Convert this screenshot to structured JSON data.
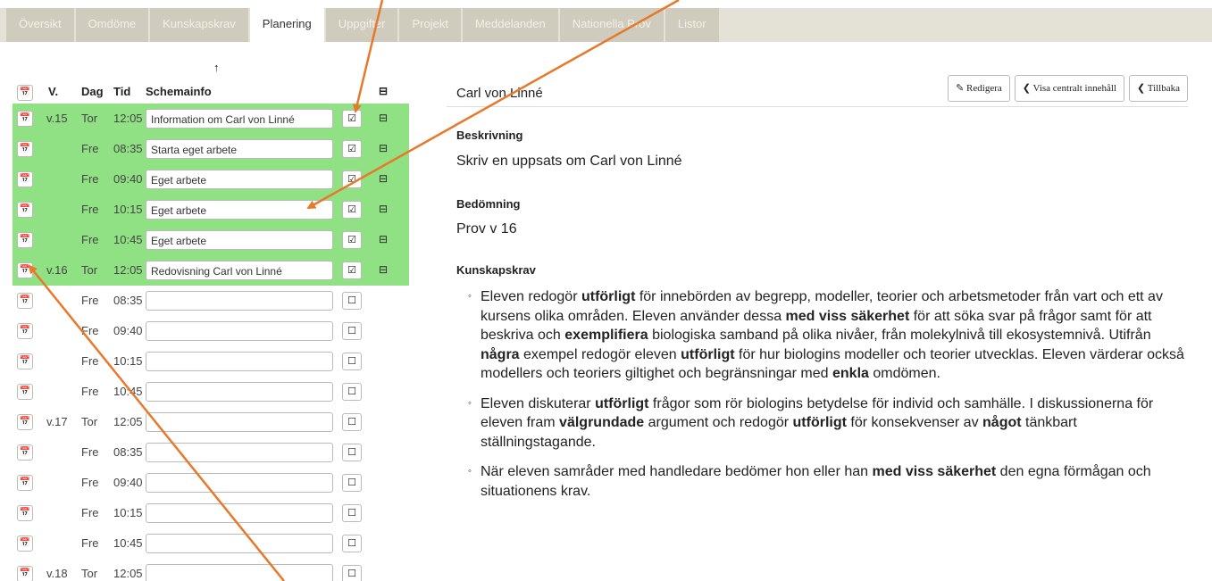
{
  "tabs": [
    {
      "label": "Översikt",
      "active": false
    },
    {
      "label": "Omdöme",
      "active": false
    },
    {
      "label": "Kunskapskrav",
      "active": false
    },
    {
      "label": "Planering",
      "active": true
    },
    {
      "label": "Uppgifter",
      "active": false
    },
    {
      "label": "Projekt",
      "active": false
    },
    {
      "label": "Meddelanden",
      "active": false
    },
    {
      "label": "Nationella Prov",
      "active": false
    },
    {
      "label": "Listor",
      "active": false
    }
  ],
  "schedule": {
    "sort_arrow": "↑",
    "columns": {
      "week": "V.",
      "day": "Dag",
      "time": "Tid",
      "info": "Schemainfo"
    },
    "rows": [
      {
        "week": "v.15",
        "day": "Tor",
        "time": "12:05",
        "info": "Information om Carl von Linné",
        "checked": true,
        "green": true
      },
      {
        "week": "",
        "day": "Fre",
        "time": "08:35",
        "info": "Starta eget arbete",
        "checked": true,
        "green": true
      },
      {
        "week": "",
        "day": "Fre",
        "time": "09:40",
        "info": "Eget arbete",
        "checked": true,
        "green": true
      },
      {
        "week": "",
        "day": "Fre",
        "time": "10:15",
        "info": "Eget arbete",
        "checked": true,
        "green": true
      },
      {
        "week": "",
        "day": "Fre",
        "time": "10:45",
        "info": "Eget arbete",
        "checked": true,
        "green": true
      },
      {
        "week": "v.16",
        "day": "Tor",
        "time": "12:05",
        "info": "Redovisning Carl von Linné",
        "checked": true,
        "green": true
      },
      {
        "week": "",
        "day": "Fre",
        "time": "08:35",
        "info": "",
        "checked": false,
        "green": false
      },
      {
        "week": "",
        "day": "Fre",
        "time": "09:40",
        "info": "",
        "checked": false,
        "green": false
      },
      {
        "week": "",
        "day": "Fre",
        "time": "10:15",
        "info": "",
        "checked": false,
        "green": false
      },
      {
        "week": "",
        "day": "Fre",
        "time": "10:45",
        "info": "",
        "checked": false,
        "green": false
      },
      {
        "week": "v.17",
        "day": "Tor",
        "time": "12:05",
        "info": "",
        "checked": false,
        "green": false
      },
      {
        "week": "",
        "day": "Fre",
        "time": "08:35",
        "info": "",
        "checked": false,
        "green": false
      },
      {
        "week": "",
        "day": "Fre",
        "time": "09:40",
        "info": "",
        "checked": false,
        "green": false
      },
      {
        "week": "",
        "day": "Fre",
        "time": "10:15",
        "info": "",
        "checked": false,
        "green": false
      },
      {
        "week": "",
        "day": "Fre",
        "time": "10:45",
        "info": "",
        "checked": false,
        "green": false
      },
      {
        "week": "v.18",
        "day": "Tor",
        "time": "12:05",
        "info": "",
        "checked": false,
        "green": false
      }
    ]
  },
  "detail": {
    "title": "Carl von Linné",
    "buttons": {
      "edit": "Redigera",
      "central": "Visa centralt innehåll",
      "back": "Tillbaka"
    },
    "description_label": "Beskrivning",
    "description": "Skriv en uppsats om Carl von Linné",
    "assessment_label": "Bedömning",
    "assessment": "Prov v 16",
    "criteria_label": "Kunskapskrav",
    "criteria": [
      [
        {
          "t": "Eleven redogör ",
          "b": false
        },
        {
          "t": "utförligt",
          "b": true
        },
        {
          "t": " för innebörden av begrepp, modeller, teorier och arbetsmetoder från vart och ett av kursens olika områden. Eleven använder dessa ",
          "b": false
        },
        {
          "t": "med viss säkerhet",
          "b": true
        },
        {
          "t": " för att söka svar på frågor samt för att beskriva och ",
          "b": false
        },
        {
          "t": "exemplifiera",
          "b": true
        },
        {
          "t": " biologiska samband på olika nivåer, från molekylnivå till ekosystemnivå. Utifrån ",
          "b": false
        },
        {
          "t": "några",
          "b": true
        },
        {
          "t": " exempel redogör eleven ",
          "b": false
        },
        {
          "t": "utförligt",
          "b": true
        },
        {
          "t": " för hur biologins modeller och teorier utvecklas. Eleven värderar också modellers och teoriers giltighet och begränsningar med ",
          "b": false
        },
        {
          "t": "enkla",
          "b": true
        },
        {
          "t": " omdömen.",
          "b": false
        }
      ],
      [
        {
          "t": "Eleven diskuterar ",
          "b": false
        },
        {
          "t": "utförligt",
          "b": true
        },
        {
          "t": " frågor som rör biologins betydelse för individ och samhälle. I diskussionerna för eleven fram ",
          "b": false
        },
        {
          "t": "välgrundade",
          "b": true
        },
        {
          "t": " argument och redogör ",
          "b": false
        },
        {
          "t": "utförligt",
          "b": true
        },
        {
          "t": " för konsekvenser av ",
          "b": false
        },
        {
          "t": "något",
          "b": true
        },
        {
          "t": " tänkbart ställningstagande.",
          "b": false
        }
      ],
      [
        {
          "t": "När eleven samråder med handledare bedömer hon eller han ",
          "b": false
        },
        {
          "t": "med viss säkerhet",
          "b": true
        },
        {
          "t": " den egna förmågan och situationens krav.",
          "b": false
        }
      ]
    ]
  },
  "colors": {
    "row_green": "#90e184",
    "annotation": "#e8782a",
    "tab_bg": "#cfcbbd"
  }
}
